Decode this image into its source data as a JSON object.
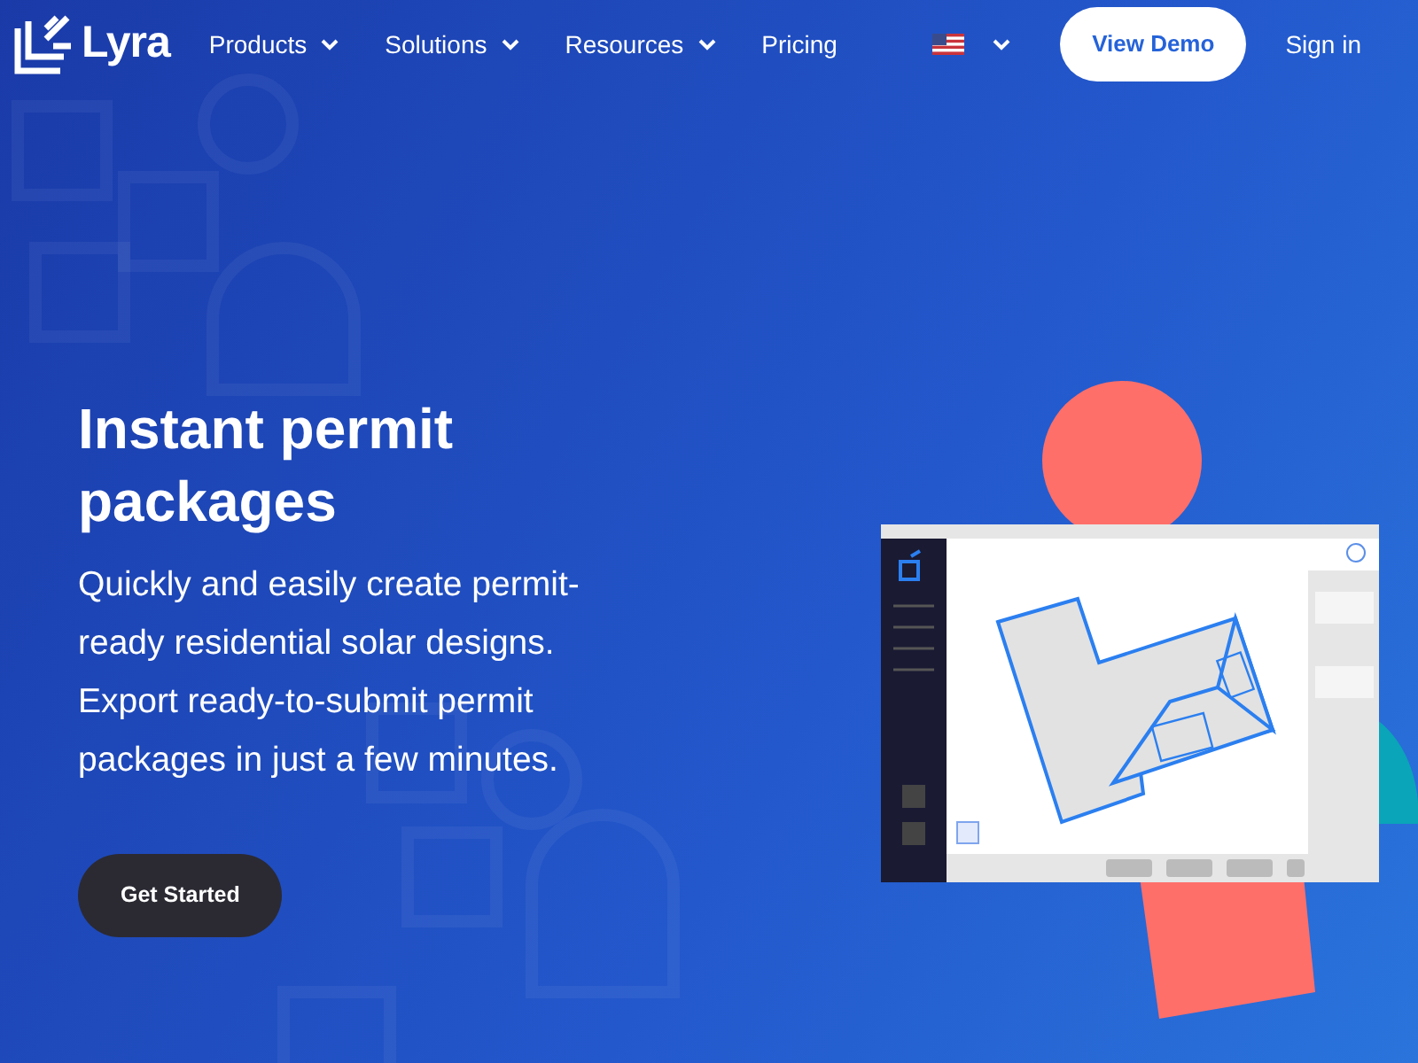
{
  "brand": {
    "name": "Lyra"
  },
  "nav": [
    {
      "label": "Products",
      "dropdown": true
    },
    {
      "label": "Solutions",
      "dropdown": true
    },
    {
      "label": "Resources",
      "dropdown": true
    },
    {
      "label": "Pricing",
      "dropdown": false
    }
  ],
  "language": {
    "dropdown": true
  },
  "buttons": {
    "demo": "View Demo",
    "signin": "Sign in"
  },
  "hero": {
    "title": "Instant permit packages",
    "text": "Quickly and easily create permit-ready residential solar designs. Export ready-to-submit permit packages in just a few minutes.",
    "cta": "Get Started"
  }
}
